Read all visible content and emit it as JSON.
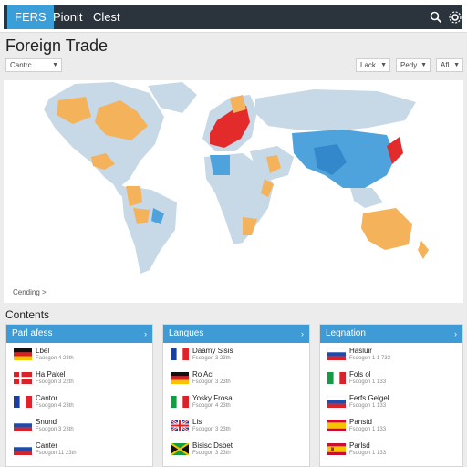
{
  "nav": {
    "tabs": [
      {
        "label": "FERS",
        "active": true
      },
      {
        "label": "Pionit",
        "active": false
      },
      {
        "label": "Clest",
        "active": false
      }
    ],
    "icons": [
      "search-icon",
      "gear-icon"
    ]
  },
  "page": {
    "title": "Foreign Trade",
    "filter_left": "Cantrc",
    "filters_right": [
      "Lack",
      "Pedy",
      "Afl"
    ]
  },
  "map": {
    "link_label": "Cending >"
  },
  "contents": {
    "title": "Contents",
    "panels": [
      {
        "title": "Parl afess",
        "rows": [
          {
            "flag": "germany",
            "name": "Lbel",
            "sub": "Faosgon 4 23th"
          },
          {
            "flag": "denmark",
            "name": "Ha Pakel",
            "sub": "Fsoogon 3 22th"
          },
          {
            "flag": "france",
            "name": "Cantor",
            "sub": "Fsoogon 4 23th"
          },
          {
            "flag": "russia",
            "name": "Snund",
            "sub": "Fsoogon 3 23th"
          },
          {
            "flag": "russia",
            "name": "Canter",
            "sub": "Fsoogon 11 23th"
          }
        ]
      },
      {
        "title": "Langues",
        "rows": [
          {
            "flag": "france",
            "name": "Daamy Sisis",
            "sub": "Fsoogon 3 23th"
          },
          {
            "flag": "germany",
            "name": "Ro Acl",
            "sub": "Fsoogon 3 23th"
          },
          {
            "flag": "italy",
            "name": "Yosky Frosal",
            "sub": "Fsoogon 4 23th"
          },
          {
            "flag": "uk",
            "name": "Lis",
            "sub": "Fsoogon 3 23th"
          },
          {
            "flag": "jamaica",
            "name": "Bisisc Dsbet",
            "sub": "Fsoogon 3 23th"
          }
        ]
      },
      {
        "title": "Legnation",
        "rows": [
          {
            "flag": "russia",
            "name": "Hasluir",
            "sub": "Fsoogon 1 1 733"
          },
          {
            "flag": "italy",
            "name": "Fols ol",
            "sub": "Fsoogon 1 133"
          },
          {
            "flag": "russia",
            "name": "Ferfs Gelgel",
            "sub": "Fsoogon 1 133"
          },
          {
            "flag": "spain",
            "name": "Panstd",
            "sub": "Fsoogon 1 133"
          },
          {
            "flag": "spain",
            "name": "Parlsd",
            "sub": "Fsoogon 1 133"
          }
        ]
      }
    ]
  },
  "colors": {
    "accent": "#3a9fd8",
    "nav_bg": "#2b333d",
    "land": "#c7d8e7",
    "trade_orange": "#f4b35a",
    "trade_red": "#e32b2b",
    "trade_blue": "#4fa3dd"
  }
}
